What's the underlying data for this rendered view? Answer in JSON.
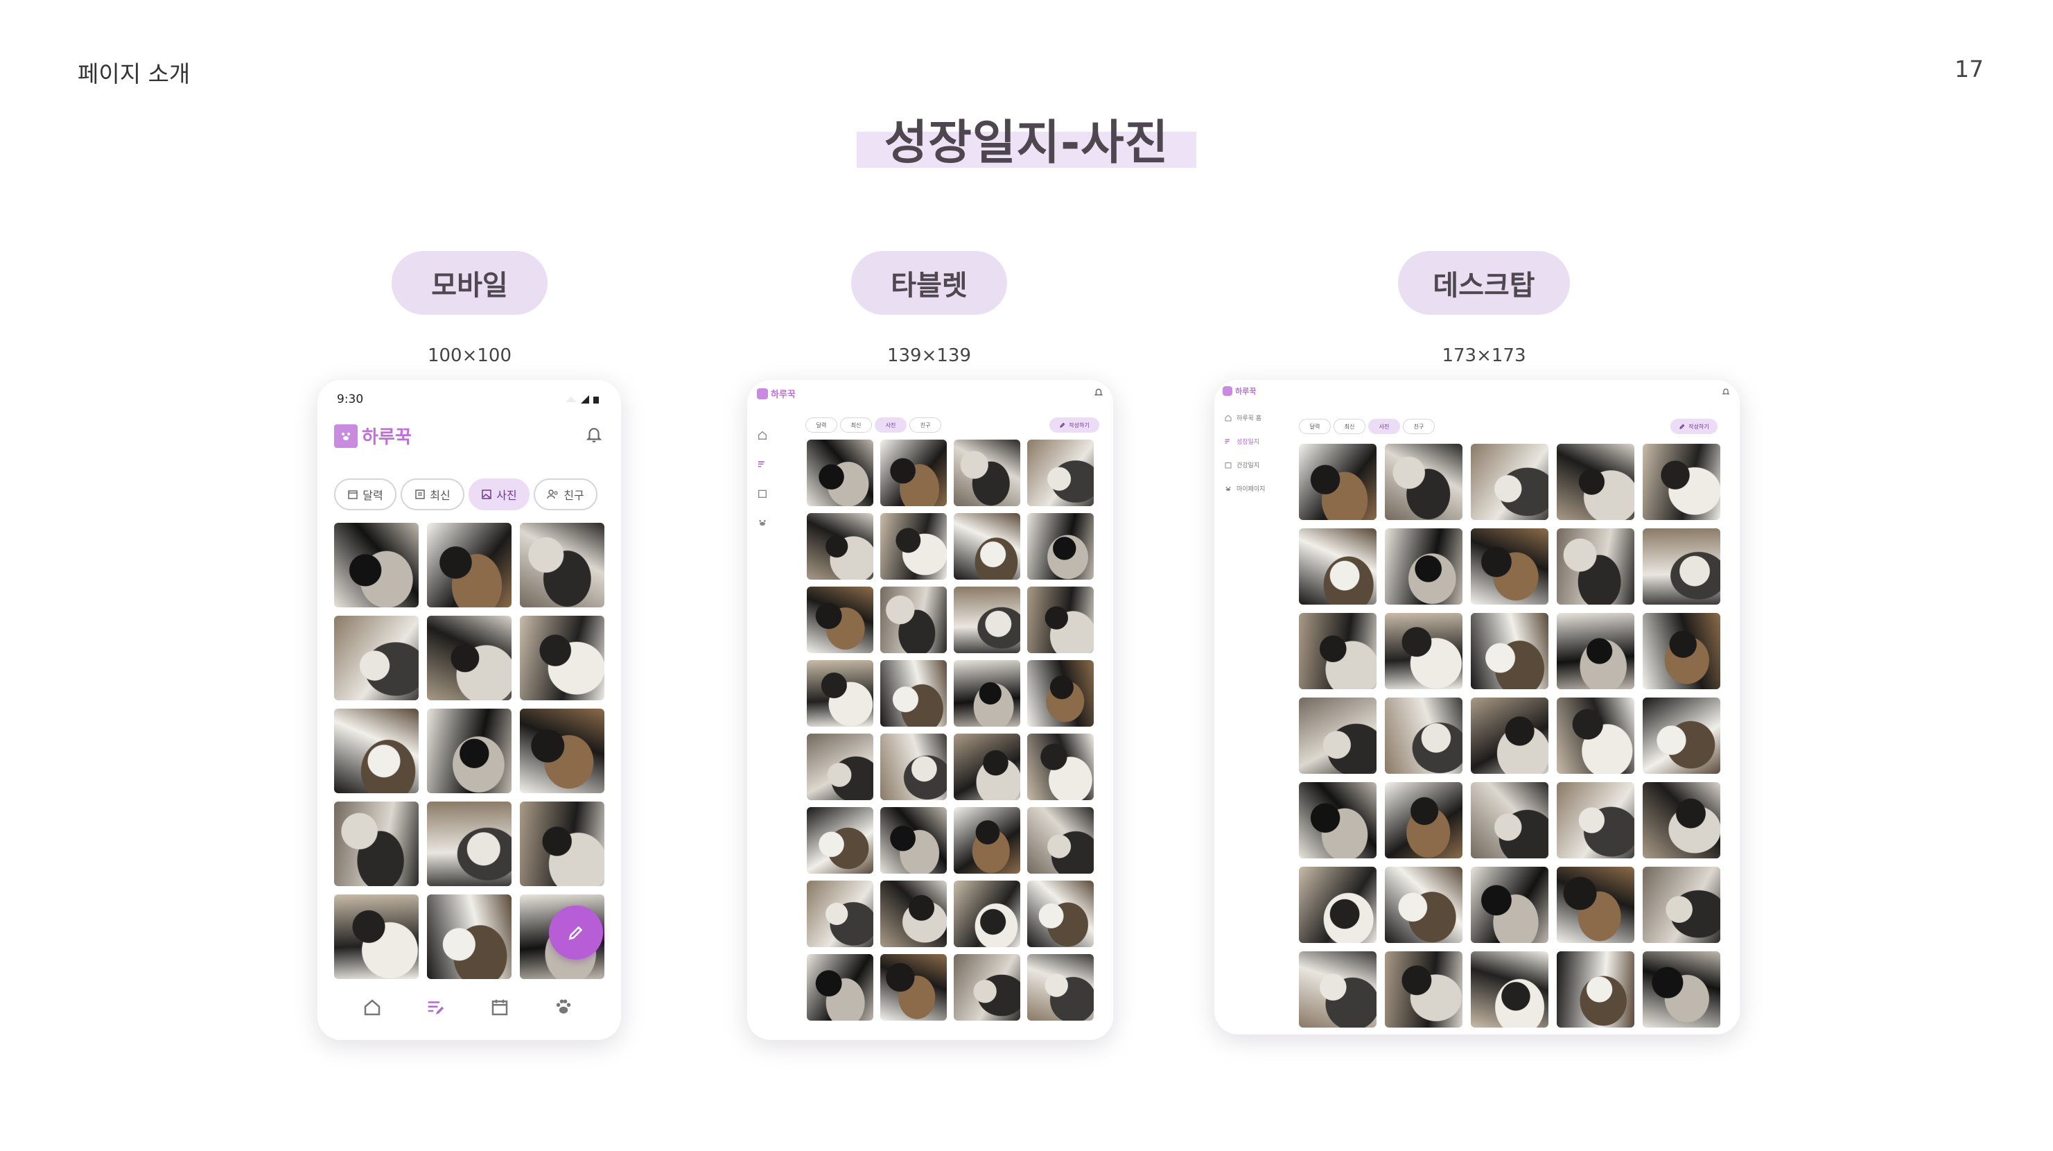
{
  "slide": {
    "section_label": "페이지 소개",
    "page_number": "17",
    "title": "성장일지-사진",
    "accent_color": "#c06fd8",
    "highlight_color": "#ede2f6"
  },
  "devices": [
    {
      "key": "mobile",
      "label": "모바일",
      "thumb_size": "100×100"
    },
    {
      "key": "tablet",
      "label": "타블렛",
      "thumb_size": "139×139"
    },
    {
      "key": "desktop",
      "label": "데스크탑",
      "thumb_size": "173×173"
    }
  ],
  "app": {
    "name": "하루꾹",
    "status_time": "9:30",
    "tabs": [
      {
        "label": "달력",
        "icon": "calendar-icon",
        "active": false
      },
      {
        "label": "최신",
        "icon": "list-icon",
        "active": false
      },
      {
        "label": "사진",
        "icon": "photo-icon",
        "active": true
      },
      {
        "label": "친구",
        "icon": "friends-icon",
        "active": false
      }
    ],
    "write_button": "작성하기",
    "sidebar": [
      {
        "label": "하루꾹 홈",
        "icon": "home-icon",
        "active": false
      },
      {
        "label": "성장일지",
        "icon": "journal-icon",
        "active": true
      },
      {
        "label": "건강일지",
        "icon": "calendar-icon",
        "active": false
      },
      {
        "label": "마이페이지",
        "icon": "paw-icon",
        "active": false
      }
    ],
    "bottom_nav": [
      {
        "icon": "home-icon",
        "active": false
      },
      {
        "icon": "journal-icon",
        "active": true
      },
      {
        "icon": "calendar-icon",
        "active": false
      },
      {
        "icon": "paw-icon",
        "active": false
      }
    ]
  },
  "photo_grid": {
    "mobile_count": 15,
    "tablet_count": 32,
    "desktop_count": 35
  }
}
